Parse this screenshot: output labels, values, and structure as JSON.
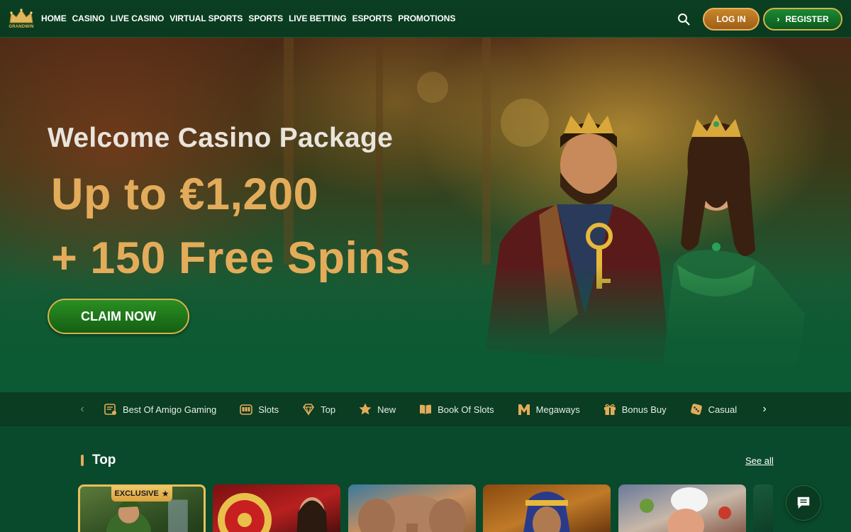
{
  "header": {
    "logo_text": "GRANDWIN",
    "nav": [
      "HOME",
      "CASINO",
      "LIVE CASINO",
      "VIRTUAL SPORTS",
      "SPORTS",
      "LIVE BETTING",
      "ESPORTS",
      "PROMOTIONS"
    ],
    "login_label": "LOG IN",
    "register_label": "REGISTER",
    "search_icon": "search-icon"
  },
  "hero": {
    "title": "Welcome Casino Package",
    "amount": "Up to €1,200",
    "spins": "+ 150 Free Spins",
    "cta_label": "CLAIM NOW"
  },
  "categories": [
    {
      "label": "Best Of Amigo Gaming",
      "icon": "certificate-icon"
    },
    {
      "label": "Slots",
      "icon": "slot-machine-icon"
    },
    {
      "label": "Top",
      "icon": "diamond-icon"
    },
    {
      "label": "New",
      "icon": "star-icon"
    },
    {
      "label": "Book Of Slots",
      "icon": "book-icon"
    },
    {
      "label": "Megaways",
      "icon": "megaways-m-icon"
    },
    {
      "label": "Bonus Buy",
      "icon": "gift-icon"
    },
    {
      "label": "Casual",
      "icon": "dice-icon"
    }
  ],
  "top_section": {
    "title": "Top",
    "see_all": "See all",
    "exclusive_badge": "EXCLUSIVE"
  },
  "colors": {
    "accent_gold": "#e3ac5a",
    "bg_green": "#0a4a2c",
    "header_green": "#0b3f22"
  }
}
